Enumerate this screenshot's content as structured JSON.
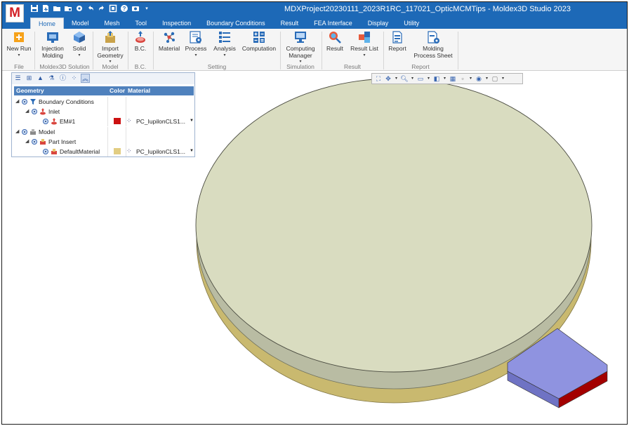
{
  "app": {
    "logo_letter": "M",
    "window_title": "MDXProject20230111_2023R1RC_117021_OpticMCMTips - Moldex3D Studio 2023"
  },
  "quick_access": [
    "save-icon",
    "new-icon",
    "open-folder-icon",
    "open-project-icon",
    "settings-icon",
    "undo-icon",
    "redo-icon",
    "sheet-icon",
    "help-icon",
    "camera-icon",
    "dropdown-icon"
  ],
  "tabs": [
    "Home",
    "Model",
    "Mesh",
    "Tool",
    "Inspection",
    "Boundary Conditions",
    "Result",
    "FEA Interface",
    "Display",
    "Utility"
  ],
  "active_tab": "Home",
  "ribbon": {
    "buttons": {
      "new_run": "New Run",
      "injection_molding": "Injection Molding",
      "solid": "Solid",
      "import_geometry": "Import Geometry",
      "bc": "B.C.",
      "material": "Material",
      "process": "Process",
      "analysis": "Analysis",
      "computation": "Computation",
      "computing_manager": "Computing Manager",
      "result": "Result",
      "result_list": "Result List",
      "report": "Report",
      "molding_process_sheet": "Molding Process Sheet"
    },
    "groups": {
      "file": "File",
      "solution": "Moldex3D Solution",
      "model": "Model",
      "bc": "B.C.",
      "setting": "Setting",
      "simulation": "Simulation",
      "result": "Result",
      "report": "Report"
    }
  },
  "tree": {
    "columns": {
      "geometry": "Geometry",
      "color": "Color",
      "material": "Material"
    },
    "rows": {
      "boundary_conditions": "Boundary Conditions",
      "inlet": "Inlet",
      "em1": "EM#1",
      "em1_material": "PC_IupilonCLS1...",
      "model": "Model",
      "part_insert": "Part Insert",
      "default_material": "DefaultMaterial",
      "default_material_material": "PC_IupilonCLS1..."
    },
    "colors": {
      "em1": "#cc1111",
      "default_material": "#e2cd82"
    }
  },
  "viewport": {
    "disc_top_color": "#d9dcc0",
    "disc_side_color": "#b9bca3",
    "disc_base_color": "#c9b96f",
    "inlet_color": "#8f93e0",
    "inlet_red_color": "#a30000"
  }
}
